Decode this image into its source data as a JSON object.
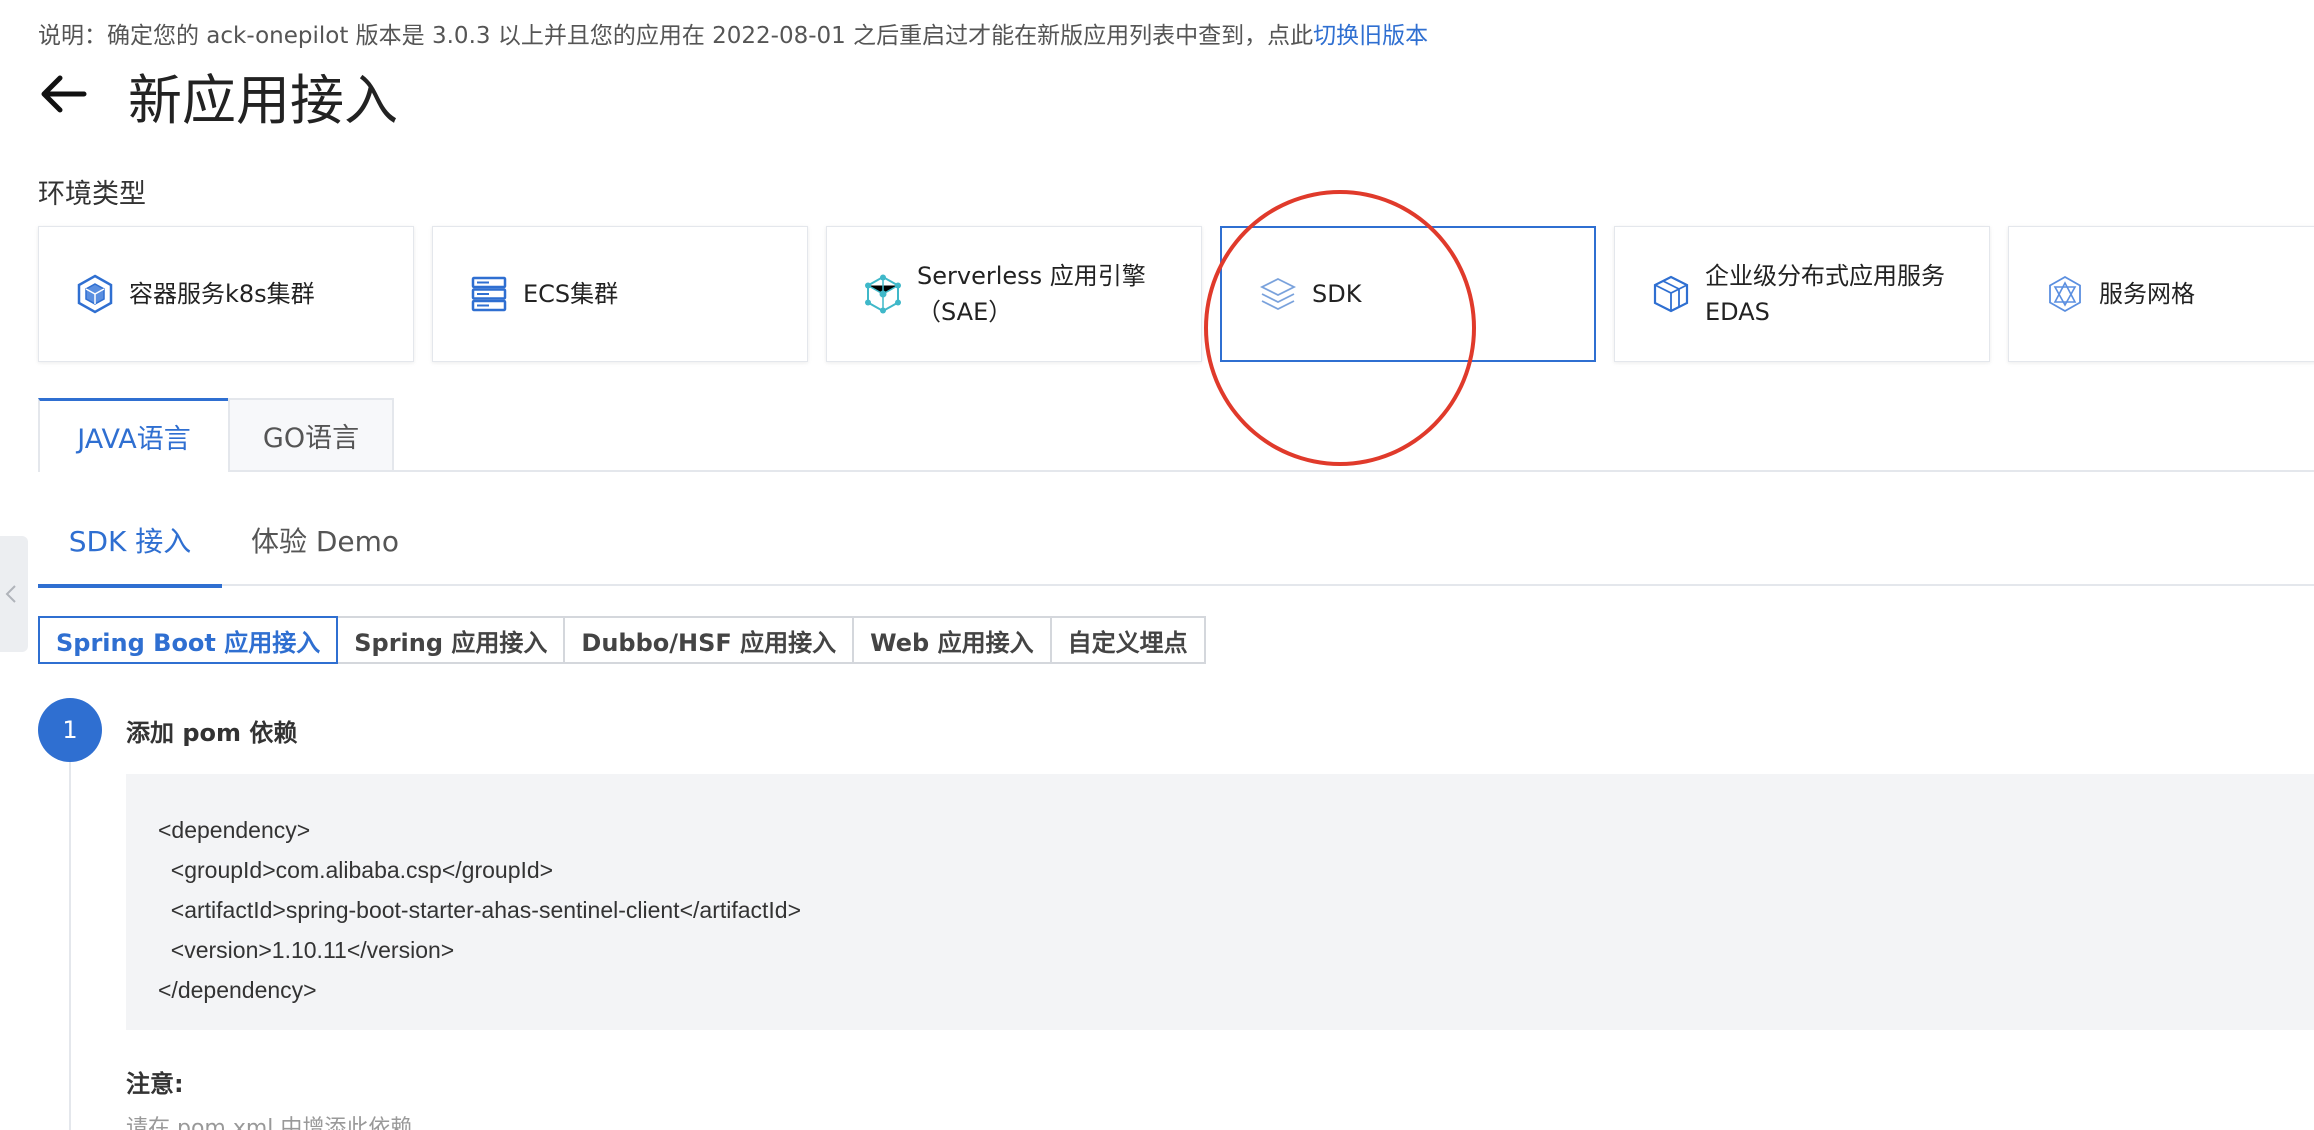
{
  "notice": {
    "text": "说明：确定您的 ack-onepilot 版本是 3.0.3 以上并且您的应用在 2022-08-01 之后重启过才能在新版应用列表中查到，点此",
    "link": "切换旧版本"
  },
  "header": {
    "title": "新应用接入",
    "back_icon": "arrow-left-icon"
  },
  "env": {
    "label": "环境类型",
    "cards": [
      {
        "label": "容器服务k8s集群",
        "icon": "k8s-cube-icon",
        "active": false
      },
      {
        "label": "ECS集群",
        "icon": "server-rack-icon",
        "active": false
      },
      {
        "label": "Serverless 应用引擎\n（SAE）",
        "icon": "serverless-node-icon",
        "active": false
      },
      {
        "label": "SDK",
        "icon": "sdk-layers-icon",
        "active": true
      },
      {
        "label": "企业级分布式应用服务\nEDAS",
        "icon": "edas-box-icon",
        "active": false
      },
      {
        "label": "服务网格",
        "icon": "mesh-hexagon-icon",
        "active": false
      }
    ]
  },
  "lang_tabs": [
    {
      "label": "JAVA语言",
      "active": true
    },
    {
      "label": "GO语言",
      "active": false
    }
  ],
  "sub_tabs": [
    {
      "label": "SDK 接入",
      "active": true
    },
    {
      "label": "体验 Demo",
      "active": false
    }
  ],
  "segments": [
    {
      "label": "Spring Boot 应用接入",
      "active": true
    },
    {
      "label": "Spring 应用接入",
      "active": false
    },
    {
      "label": "Dubbo/HSF 应用接入",
      "active": false
    },
    {
      "label": "Web 应用接入",
      "active": false
    },
    {
      "label": "自定义埋点",
      "active": false
    }
  ],
  "step": {
    "number": "1",
    "title": "添加 pom 依赖",
    "code": [
      "<dependency>",
      "  <groupId>com.alibaba.csp</groupId>",
      "  <artifactId>spring-boot-starter-ahas-sentinel-client</artifactId>",
      "  <version>1.10.11</version>",
      "</dependency>"
    ],
    "note_title": "注意:",
    "note_text": "请在 pom.xml 中增添此依赖"
  },
  "colors": {
    "accent": "#2f6fd1",
    "annotation": "#e03a2b"
  }
}
